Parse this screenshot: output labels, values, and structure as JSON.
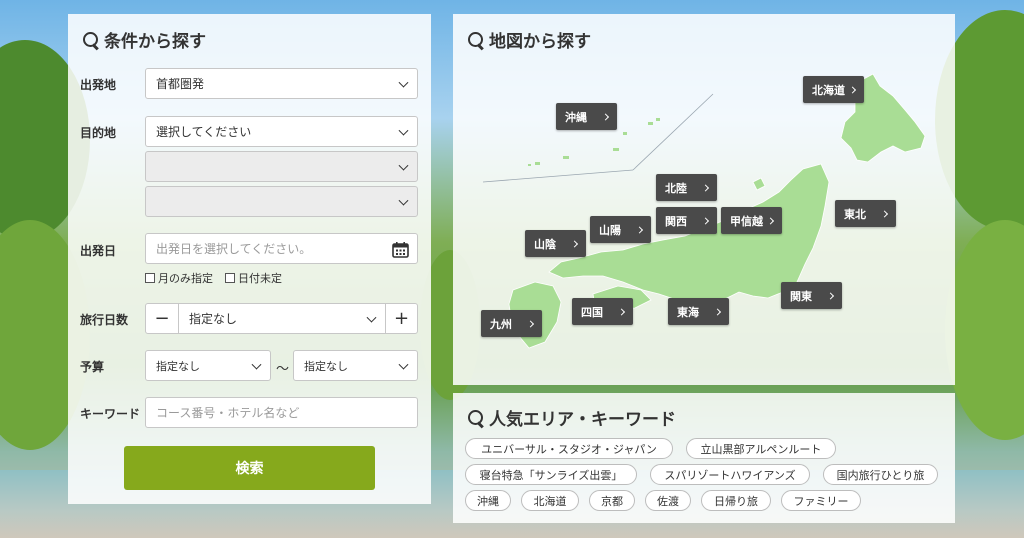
{
  "search_panel": {
    "title": "条件から探す",
    "departure": {
      "label": "出発地",
      "value": "首都圏発"
    },
    "destination": {
      "label": "目的地",
      "value": "選択してください",
      "sub1": "",
      "sub2": ""
    },
    "date": {
      "label": "出発日",
      "placeholder": "出発日を選択してください。",
      "opt_month": "月のみ指定",
      "opt_undecided": "日付未定"
    },
    "days": {
      "label": "旅行日数",
      "minus": "−",
      "value": "指定なし",
      "plus": "+"
    },
    "budget": {
      "label": "予算",
      "min": "指定なし",
      "tilde": "〜",
      "max": "指定なし"
    },
    "keyword": {
      "label": "キーワード",
      "placeholder": "コース番号・ホテル名など"
    },
    "submit_label": "検索"
  },
  "map_panel": {
    "title": "地図から探す",
    "regions": {
      "hokkaido": "北海道",
      "okinawa": "沖縄",
      "hokuriku": "北陸",
      "tohoku": "東北",
      "kansai": "関西",
      "koshinetsu": "甲信越",
      "sanyo": "山陽",
      "sanin": "山陰",
      "kanto": "関東",
      "shikoku": "四国",
      "tokai": "東海",
      "kyushu": "九州"
    },
    "map_color": "#a9dd95"
  },
  "keyword_panel": {
    "title": "人気エリア・キーワード",
    "tags": [
      "ユニバーサル・スタジオ・ジャパン",
      "立山黒部アルペンルート",
      "寝台特急「サンライズ出雲」",
      "スパリゾートハワイアンズ",
      "国内旅行ひとり旅",
      "沖縄",
      "北海道",
      "京都",
      "佐渡",
      "日帰り旅",
      "ファミリー"
    ]
  },
  "colors": {
    "accent_green": "#86a91c",
    "region_button": "#4a4a4a"
  }
}
